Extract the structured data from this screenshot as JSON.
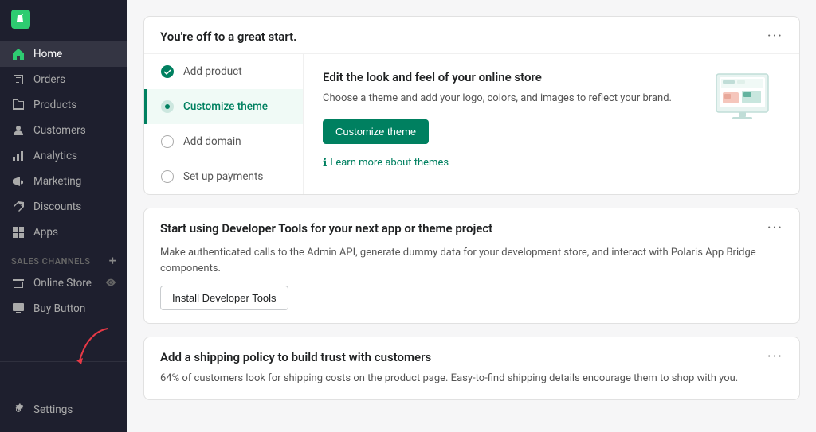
{
  "sidebar": {
    "logo_text": "Shopify",
    "nav_items": [
      {
        "id": "home",
        "label": "Home",
        "active": true
      },
      {
        "id": "orders",
        "label": "Orders",
        "active": false
      },
      {
        "id": "products",
        "label": "Products",
        "active": false
      },
      {
        "id": "customers",
        "label": "Customers",
        "active": false
      },
      {
        "id": "analytics",
        "label": "Analytics",
        "active": false
      },
      {
        "id": "marketing",
        "label": "Marketing",
        "active": false
      },
      {
        "id": "discounts",
        "label": "Discounts",
        "active": false
      },
      {
        "id": "apps",
        "label": "Apps",
        "active": false
      }
    ],
    "channels_label": "SALES CHANNELS",
    "channel_items": [
      {
        "id": "online-store",
        "label": "Online Store"
      },
      {
        "id": "buy-button",
        "label": "Buy Button"
      }
    ],
    "settings_label": "Settings"
  },
  "getting_started": {
    "title": "You're off to a great start.",
    "steps": [
      {
        "id": "add-product",
        "label": "Add product",
        "completed": true
      },
      {
        "id": "customize-theme",
        "label": "Customize theme",
        "active": true
      },
      {
        "id": "add-domain",
        "label": "Add domain",
        "active": false
      },
      {
        "id": "set-up-payments",
        "label": "Set up payments",
        "active": false
      }
    ],
    "content": {
      "title": "Edit the look and feel of your online store",
      "description": "Choose a theme and add your logo, colors, and images to reflect your brand.",
      "cta_label": "Customize theme",
      "learn_link": "Learn more about themes"
    }
  },
  "dev_tools": {
    "title": "Start using Developer Tools for your next app or theme project",
    "description": "Make authenticated calls to the Admin API, generate dummy data for your development store, and interact with Polaris App Bridge components.",
    "install_label": "Install Developer Tools"
  },
  "shipping": {
    "title": "Add a shipping policy to build trust with customers",
    "description": "64% of customers look for shipping costs on the product page. Easy-to-find shipping details encourage them to shop with you."
  },
  "icons": {
    "home": "⌂",
    "orders": "📋",
    "products": "🏷",
    "customers": "👤",
    "analytics": "📊",
    "marketing": "📢",
    "discounts": "🏷",
    "apps": "⊞",
    "online_store": "🏪",
    "buy_button": "🛒",
    "settings": "⚙",
    "check": "✓",
    "theme": "🎨",
    "domain": "🌐",
    "payment": "💳",
    "info": "ℹ"
  },
  "colors": {
    "accent": "#008060",
    "sidebar_bg": "#1b1b2c",
    "active_nav": "rgba(255,255,255,0.1)"
  }
}
